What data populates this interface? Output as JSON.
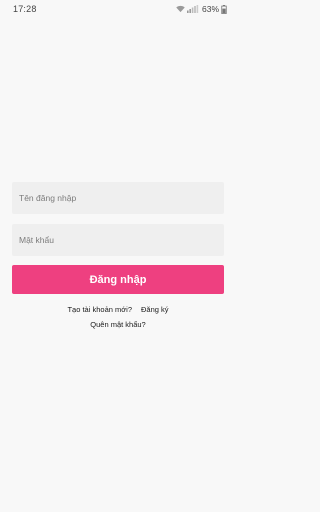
{
  "status_bar": {
    "time": "17:28",
    "battery": "63%",
    "icons": [
      "wifi-icon",
      "signal-icon",
      "battery-icon"
    ]
  },
  "login": {
    "username_placeholder": "Tên đăng nhập",
    "username_value": "",
    "password_placeholder": "Mật khẩu",
    "password_value": "",
    "submit_label": "Đăng nhập",
    "create_account_prompt": "Tạo tài khoản mới?",
    "register_link": "Đăng ký",
    "forgot_password_link": "Quên mật khẩu?"
  },
  "colors": {
    "accent": "#ee4080",
    "background": "#f8f8f8",
    "field_background": "#efefef"
  }
}
